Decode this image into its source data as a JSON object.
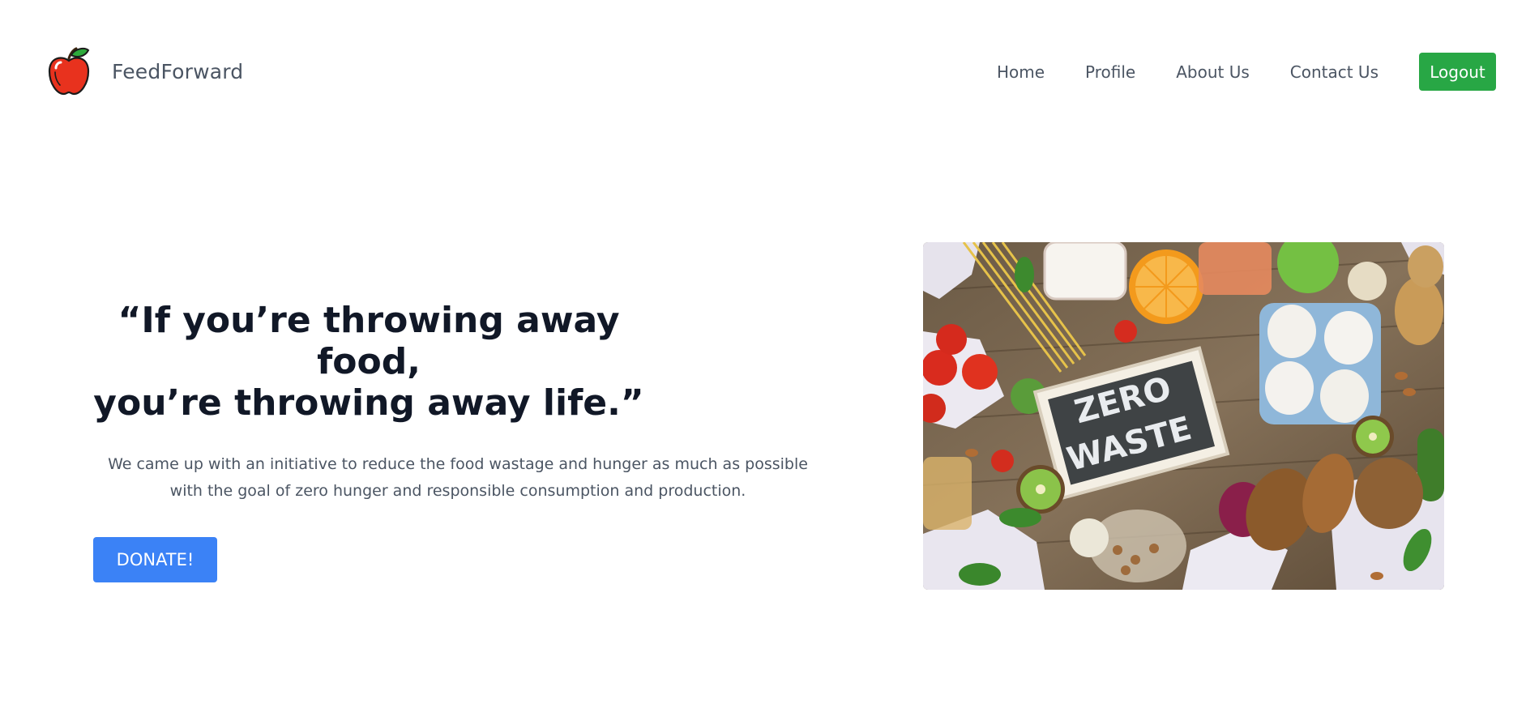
{
  "brand": {
    "name": "FeedForward",
    "logo_icon": "apple-icon"
  },
  "nav": {
    "items": [
      {
        "label": "Home"
      },
      {
        "label": "Profile"
      },
      {
        "label": "About Us"
      },
      {
        "label": "Contact Us"
      }
    ],
    "logout_label": "Logout"
  },
  "hero": {
    "quote_line1": "“If you’re throwing away food,",
    "quote_line2": "you’re throwing away life.”",
    "description": "We came up with an initiative to reduce the food wastage and hunger as much as possible with the goal of zero hunger and responsible consumption and production.",
    "donate_label": "DONATE!",
    "image_sign_line1": "ZERO",
    "image_sign_line2": "WASTE"
  },
  "colors": {
    "logout_bg": "#28a745",
    "donate_bg": "#3b82f6",
    "heading": "#111827",
    "body_text": "#4b5563"
  }
}
